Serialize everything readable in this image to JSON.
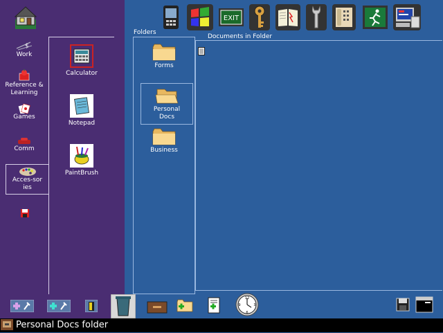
{
  "sidebar": {
    "categories": [
      {
        "label": "Work",
        "icon": "briefcase-icon"
      },
      {
        "label": "Reference & Learning",
        "icon": "book-apple-icon"
      },
      {
        "label": "Games",
        "icon": "cards-icon"
      },
      {
        "label": "Comm",
        "icon": "phone-icon"
      },
      {
        "label": "Acces-sories",
        "icon": "palette-icon"
      }
    ]
  },
  "apps": [
    {
      "label": "Calculator",
      "icon": "calculator-icon"
    },
    {
      "label": "Notepad",
      "icon": "notepad-icon"
    },
    {
      "label": "PaintBrush",
      "icon": "paintbrush-icon"
    }
  ],
  "toolbar": {
    "icons": [
      "handheld-icon",
      "windows-icon",
      "exit-sign-icon",
      "key-icon",
      "book-icon",
      "wrench-icon",
      "telephone-icon",
      "running-man-icon",
      "computer-icon"
    ]
  },
  "folders_panel": {
    "title": "Folders",
    "folders": [
      {
        "label": "Forms"
      },
      {
        "label": "Personal Docs"
      },
      {
        "label": "Business"
      }
    ]
  },
  "documents_panel": {
    "title": "Documents in Folder",
    "items": [
      "document-icon"
    ]
  },
  "bottombar": {
    "icons": [
      "add-tool-icon",
      "add-tool-icon",
      "exit-door-icon",
      "trash-icon",
      "drawer-icon",
      "new-folder-icon",
      "new-document-icon",
      "clock-icon",
      "disk-icon",
      "window-icon"
    ]
  },
  "status": {
    "text": "Personal Docs folder"
  }
}
